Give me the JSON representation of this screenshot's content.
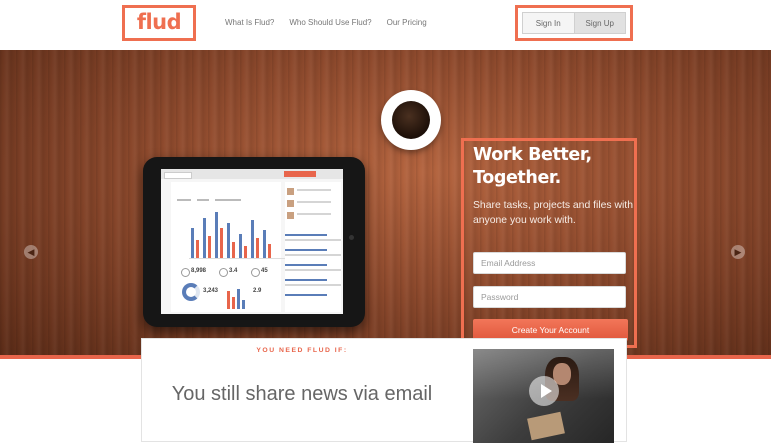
{
  "header": {
    "logo": "flud",
    "nav": [
      "What Is Flud?",
      "Who Should Use Flud?",
      "Our Pricing"
    ],
    "sign_in": "Sign In",
    "sign_up": "Sign Up"
  },
  "hero": {
    "title": "Work Better, Together.",
    "subtitle": "Share tasks, projects and files with anyone you work with.",
    "email_placeholder": "Email Address",
    "password_placeholder": "Password",
    "create_button": "Create Your Account",
    "tablet_stats": [
      "8,998",
      "3.4",
      "45",
      "3,243",
      "2.9"
    ]
  },
  "content": {
    "eyebrow": "YOU NEED FLUD IF:",
    "headline": "You still share news via email"
  },
  "colors": {
    "accent": "#ef6f50",
    "button": "#e8654b"
  },
  "icons": [
    "chevron-left-icon",
    "chevron-right-icon",
    "play-icon",
    "coffee-cup-icon"
  ]
}
